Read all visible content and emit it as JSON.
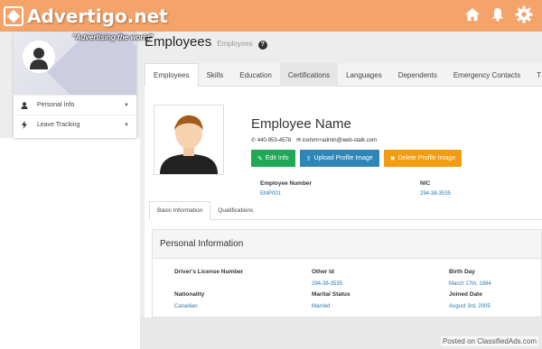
{
  "brand": {
    "name": "Advertigo.net",
    "tagline": "\"Advertising the world\""
  },
  "topbar": {
    "icons": [
      "home-icon",
      "bell-icon",
      "gear-icon"
    ],
    "color": "#f4a46a"
  },
  "sidebar": {
    "items": [
      {
        "label": "Personal Info",
        "icon": "user-icon"
      },
      {
        "label": "Leave Tracking",
        "icon": "bolt-icon"
      }
    ]
  },
  "header": {
    "title": "Employees",
    "subtitle": "Employees"
  },
  "tabs": [
    {
      "label": "Employees",
      "active": true
    },
    {
      "label": "Skills"
    },
    {
      "label": "Education"
    },
    {
      "label": "Certifications"
    },
    {
      "label": "Languages"
    },
    {
      "label": "Dependents"
    },
    {
      "label": "Emergency Contacts"
    },
    {
      "label": "T"
    }
  ],
  "employee": {
    "name": "Employee Name",
    "phone": "440-953-4578",
    "email": "icehrm+admin@web-stalk.com",
    "buttons": {
      "edit": "Edit Info",
      "upload": "Upload Profile Image",
      "delete": "Delete Profile Image"
    },
    "number_label": "Employee Number",
    "number_value": "EMP001",
    "nic_label": "NIC",
    "nic_value": "294-38-3535"
  },
  "subtabs": [
    {
      "label": "Basic Information",
      "active": true
    },
    {
      "label": "Qualifications"
    }
  ],
  "personal_info": {
    "title": "Personal Information",
    "fields": {
      "drivers_license_label": "Driver's License Number",
      "other_id_label": "Other Id",
      "other_id_value": "294-38-3535",
      "birthday_label": "Birth Day",
      "birthday_value": "March 17th, 1984",
      "nationality_label": "Nationality",
      "nationality_value": "Canadian",
      "marital_label": "Marital Status",
      "marital_value": "Married",
      "joined_label": "Joined Date",
      "joined_value": "August 3rd, 2005"
    }
  },
  "watermark": "Posted on ClassifiedAds.com",
  "colors": {
    "green": "#1fa855",
    "blue": "#2e86b8",
    "orange": "#f39c12",
    "link": "#2a7ab0"
  }
}
